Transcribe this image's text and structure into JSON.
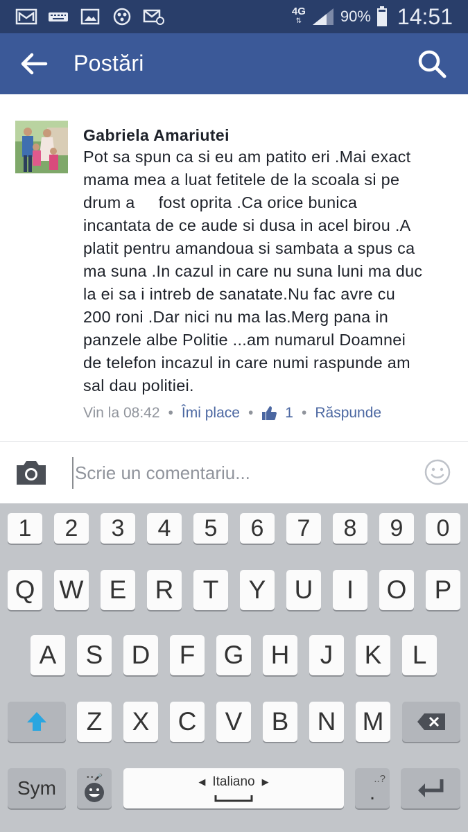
{
  "status_bar": {
    "network": "4G",
    "battery": "90%",
    "time": "14:51",
    "icons_left": [
      "gmail-icon",
      "keyboard-icon",
      "gallery-icon",
      "app-icon",
      "mail-settings-icon"
    ]
  },
  "app_bar": {
    "title": "Postări",
    "back_icon": "arrow-left-icon",
    "search_icon": "search-icon"
  },
  "comment": {
    "author": "Gabriela Amariutei",
    "text": "Pot sa spun ca si eu am patito eri .Mai exact\nmama mea a luat fetitele de la scoala si pe\ndrum a     fost oprita .Ca orice bunica\nincantata de ce aude si dusa in acel birou .A\nplatit pentru amandoua si sambata a spus ca\nma suna .In cazul in care nu suna luni ma duc\nla ei sa i intreb de sanatate.Nu fac avre cu\n200 roni .Dar nici nu ma las.Merg pana in\npanzele albe Politie ...am numarul Doamnei\nde telefon incazul in care numi raspunde am\nsal dau politiei.",
    "time": "Vin la 08:42",
    "like_label": "Îmi place",
    "like_count": "1",
    "reply_label": "Răspunde"
  },
  "composer": {
    "placeholder": "Scrie un comentariu..."
  },
  "keyboard": {
    "row_numbers": [
      "1",
      "2",
      "3",
      "4",
      "5",
      "6",
      "7",
      "8",
      "9",
      "0"
    ],
    "row1": [
      "Q",
      "W",
      "E",
      "R",
      "T",
      "Y",
      "U",
      "I",
      "O",
      "P"
    ],
    "row2": [
      "A",
      "S",
      "D",
      "F",
      "G",
      "H",
      "J",
      "K",
      "L"
    ],
    "row3": [
      "Z",
      "X",
      "C",
      "V",
      "B",
      "N",
      "M"
    ],
    "sym_label": "Sym",
    "language": "Italiano",
    "period": ".",
    "period_hint": "..?"
  },
  "colors": {
    "status_bar": "#293e6a",
    "app_bar": "#3b5998",
    "link": "#4b67a1",
    "shift_accent": "#2aa6e0"
  }
}
